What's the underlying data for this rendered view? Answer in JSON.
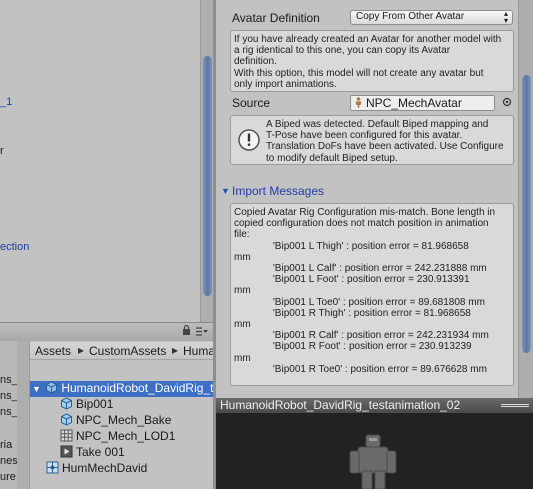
{
  "left_top": {
    "fragments": [
      "_1",
      "r",
      "ection"
    ]
  },
  "left_bottom": {
    "folder_fragments": [
      "ns_",
      "ns_",
      "ns_",
      "ria",
      "nes",
      "ure"
    ],
    "breadcrumb": [
      "Assets",
      "CustomAssets",
      "Huma"
    ],
    "assets": [
      {
        "label": "HumanoidRobot_DavidRig_t",
        "icon": "model-prefab-icon"
      },
      {
        "label": "Bip001",
        "icon": "bone-cube-icon"
      },
      {
        "label": "NPC_Mech_Bake",
        "icon": "mesh-cube-icon"
      },
      {
        "label": "NPC_Mech_LOD1",
        "icon": "mesh-grid-icon"
      },
      {
        "label": "Take 001",
        "icon": "animation-clip-icon"
      },
      {
        "label": "HumMechDavid",
        "icon": "avatar-grid-icon"
      }
    ]
  },
  "inspector": {
    "avatar_definition_label": "Avatar Definition",
    "avatar_definition_value": "Copy From Other Avatar",
    "copy_info": "If you have already created an Avatar for another model with\na rig identical to this one, you can copy its Avatar\ndefinition.\nWith this option, this model will not create any avatar but\nonly import animations.",
    "source_label": "Source",
    "source_value": "NPC_MechAvatar",
    "biped_info": "A Biped was detected. Default Biped mapping and\nT-Pose have been configured for this avatar.\nTranslation DoFs have been activated. Use Configure\nto modify default Biped setup.",
    "import_messages_label": "Import Messages",
    "messages": "Copied Avatar Rig Configuration mis-match. Bone length in\ncopied configuration does not match position in animation\nfile:\n              'Bip001 L Thigh' : position error = 81.968658\nmm\n              'Bip001 L Calf' : position error = 242.231888 mm\n              'Bip001 L Foot' : position error = 230.913391\nmm\n              'Bip001 L Toe0' : position error = 89.681808 mm\n              'Bip001 R Thigh' : position error = 81.968658\nmm\n              'Bip001 R Calf' : position error = 242.231934 mm\n              'Bip001 R Foot' : position error = 230.913239\nmm\n              'Bip001 R Toe0' : position error = 89.676628 mm"
  },
  "preview": {
    "title": "HumanoidRobot_DavidRig_testanimation_02"
  },
  "colors": {
    "link_blue": "#1f3ea8",
    "selection": "#3d6fc4",
    "scroll_thumb": "#5a76a3"
  }
}
